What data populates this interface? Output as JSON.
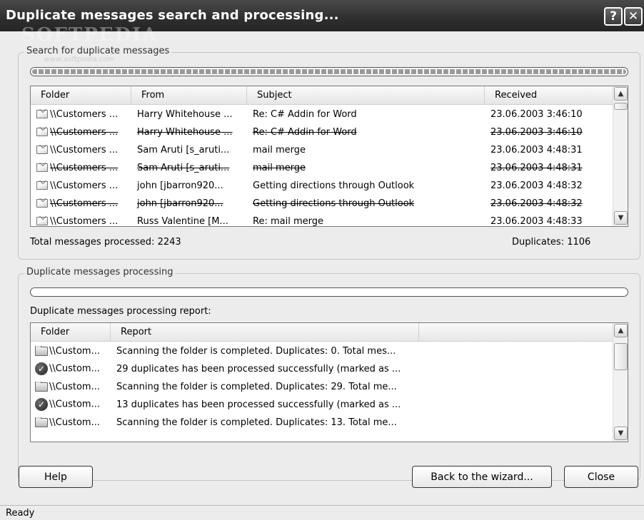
{
  "window": {
    "title": "Duplicate messages search and processing...",
    "watermark": "SOFTPEDIA",
    "watermark_url": "www.softpedia.com",
    "help_glyph": "?",
    "close_glyph": "✕"
  },
  "search_group": {
    "legend": "Search for duplicate messages",
    "progress": 1.0,
    "columns": [
      "Folder",
      "From",
      "Subject",
      "Received"
    ],
    "rows": [
      {
        "folder": "\\\\Customers ...",
        "from": "Harry Whitehouse ...",
        "subject": "Re: C# Addin for Word",
        "received": "23.06.2003 3:46:10",
        "duplicate": false
      },
      {
        "folder": "\\\\Customers ...",
        "from": "Harry Whitehouse ...",
        "subject": "Re: C# Addin for Word",
        "received": "23.06.2003 3:46:10",
        "duplicate": true
      },
      {
        "folder": "\\\\Customers ...",
        "from": "Sam Aruti [s_aruti...",
        "subject": "mail merge",
        "received": "23.06.2003 4:48:31",
        "duplicate": false
      },
      {
        "folder": "\\\\Customers ...",
        "from": "Sam Aruti [s_aruti...",
        "subject": "mail merge",
        "received": "23.06.2003 4:48:31",
        "duplicate": true
      },
      {
        "folder": "\\\\Customers ...",
        "from": "john [jbarron920...",
        "subject": "Getting directions through Outlook",
        "received": "23.06.2003 4:48:32",
        "duplicate": false
      },
      {
        "folder": "\\\\Customers ...",
        "from": "john [jbarron920...",
        "subject": "Getting directions through Outlook",
        "received": "23.06.2003 4:48:32",
        "duplicate": true
      },
      {
        "folder": "\\\\Customers ...",
        "from": "Russ Valentine [M...",
        "subject": "Re: mail merge",
        "received": "23.06.2003 4:48:33",
        "duplicate": false
      }
    ],
    "total_label": "Total messages processed:",
    "total_value": "2243",
    "duplicates_label": "Duplicates:",
    "duplicates_value": "1106"
  },
  "processing_group": {
    "legend": "Duplicate messages processing",
    "progress": 0.0,
    "report_label": "Duplicate messages processing report:",
    "columns": [
      "Folder",
      "Report"
    ],
    "rows": [
      {
        "icon": "folder-icon",
        "folder": "\\\\Custom...",
        "report": "Scanning the folder is completed. Duplicates: 0. Total mes..."
      },
      {
        "icon": "check-icon",
        "folder": "\\\\Custom...",
        "report": "29 duplicates has been processed successfully (marked as ..."
      },
      {
        "icon": "folder-icon",
        "folder": "\\\\Custom...",
        "report": "Scanning the folder is completed. Duplicates: 29. Total me..."
      },
      {
        "icon": "check-icon",
        "folder": "\\\\Custom...",
        "report": "13 duplicates has been processed successfully (marked as ..."
      },
      {
        "icon": "folder-icon",
        "folder": "\\\\Custom...",
        "report": "Scanning the folder is completed. Duplicates: 13. Total me..."
      }
    ]
  },
  "buttons": {
    "help": "Help",
    "back": "Back to the wizard...",
    "close": "Close"
  },
  "status": {
    "text": "Ready"
  }
}
